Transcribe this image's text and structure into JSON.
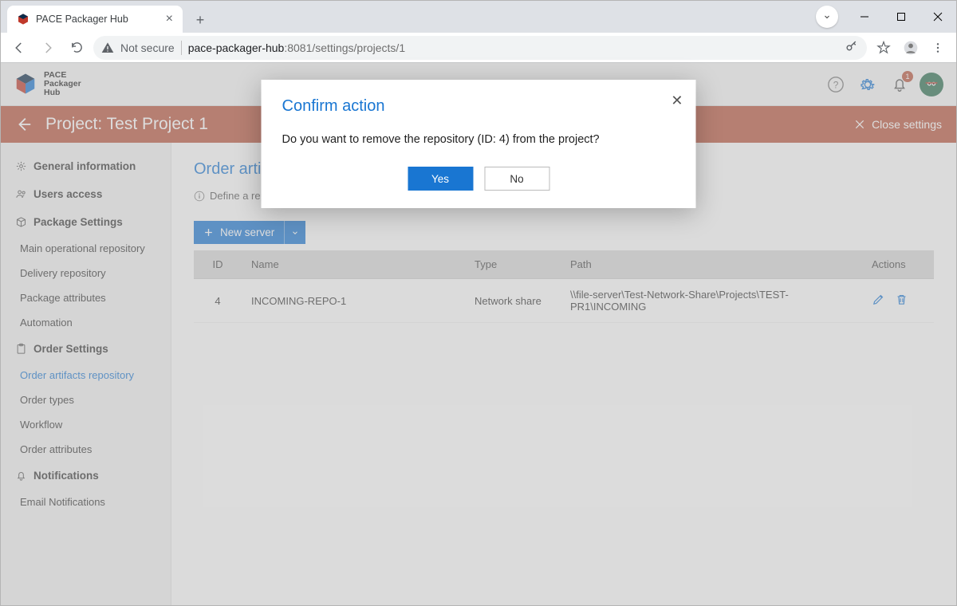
{
  "browser": {
    "tab_title": "PACE Packager Hub",
    "not_secure_label": "Not secure",
    "url_host": "pace-packager-hub",
    "url_port_path": ":8081/settings/projects/1"
  },
  "app_header": {
    "brand_line1": "PACE",
    "brand_line2": "Packager",
    "brand_line3": "Hub",
    "notification_count": "1"
  },
  "project_bar": {
    "title": "Project: Test Project 1",
    "close_label": "Close settings"
  },
  "sidebar": {
    "general": "General information",
    "users": "Users access",
    "package_head": "Package Settings",
    "package_items": [
      "Main operational repository",
      "Delivery repository",
      "Package attributes",
      "Automation"
    ],
    "order_head": "Order Settings",
    "order_items": [
      "Order artifacts repository",
      "Order types",
      "Workflow",
      "Order attributes"
    ],
    "notifications_head": "Notifications",
    "notifications_items": [
      "Email Notifications"
    ]
  },
  "main": {
    "heading": "Order artifacts repository",
    "info_prefix": "Define a repos",
    "new_server": "New server",
    "columns": {
      "id": "ID",
      "name": "Name",
      "type": "Type",
      "path": "Path",
      "actions": "Actions"
    },
    "rows": [
      {
        "id": "4",
        "name": "INCOMING-REPO-1",
        "type": "Network share",
        "path": "\\\\file-server\\Test-Network-Share\\Projects\\TEST-PR1\\INCOMING"
      }
    ]
  },
  "modal": {
    "title": "Confirm action",
    "message": "Do you want to remove the repository (ID: 4) from the project?",
    "yes": "Yes",
    "no": "No"
  }
}
